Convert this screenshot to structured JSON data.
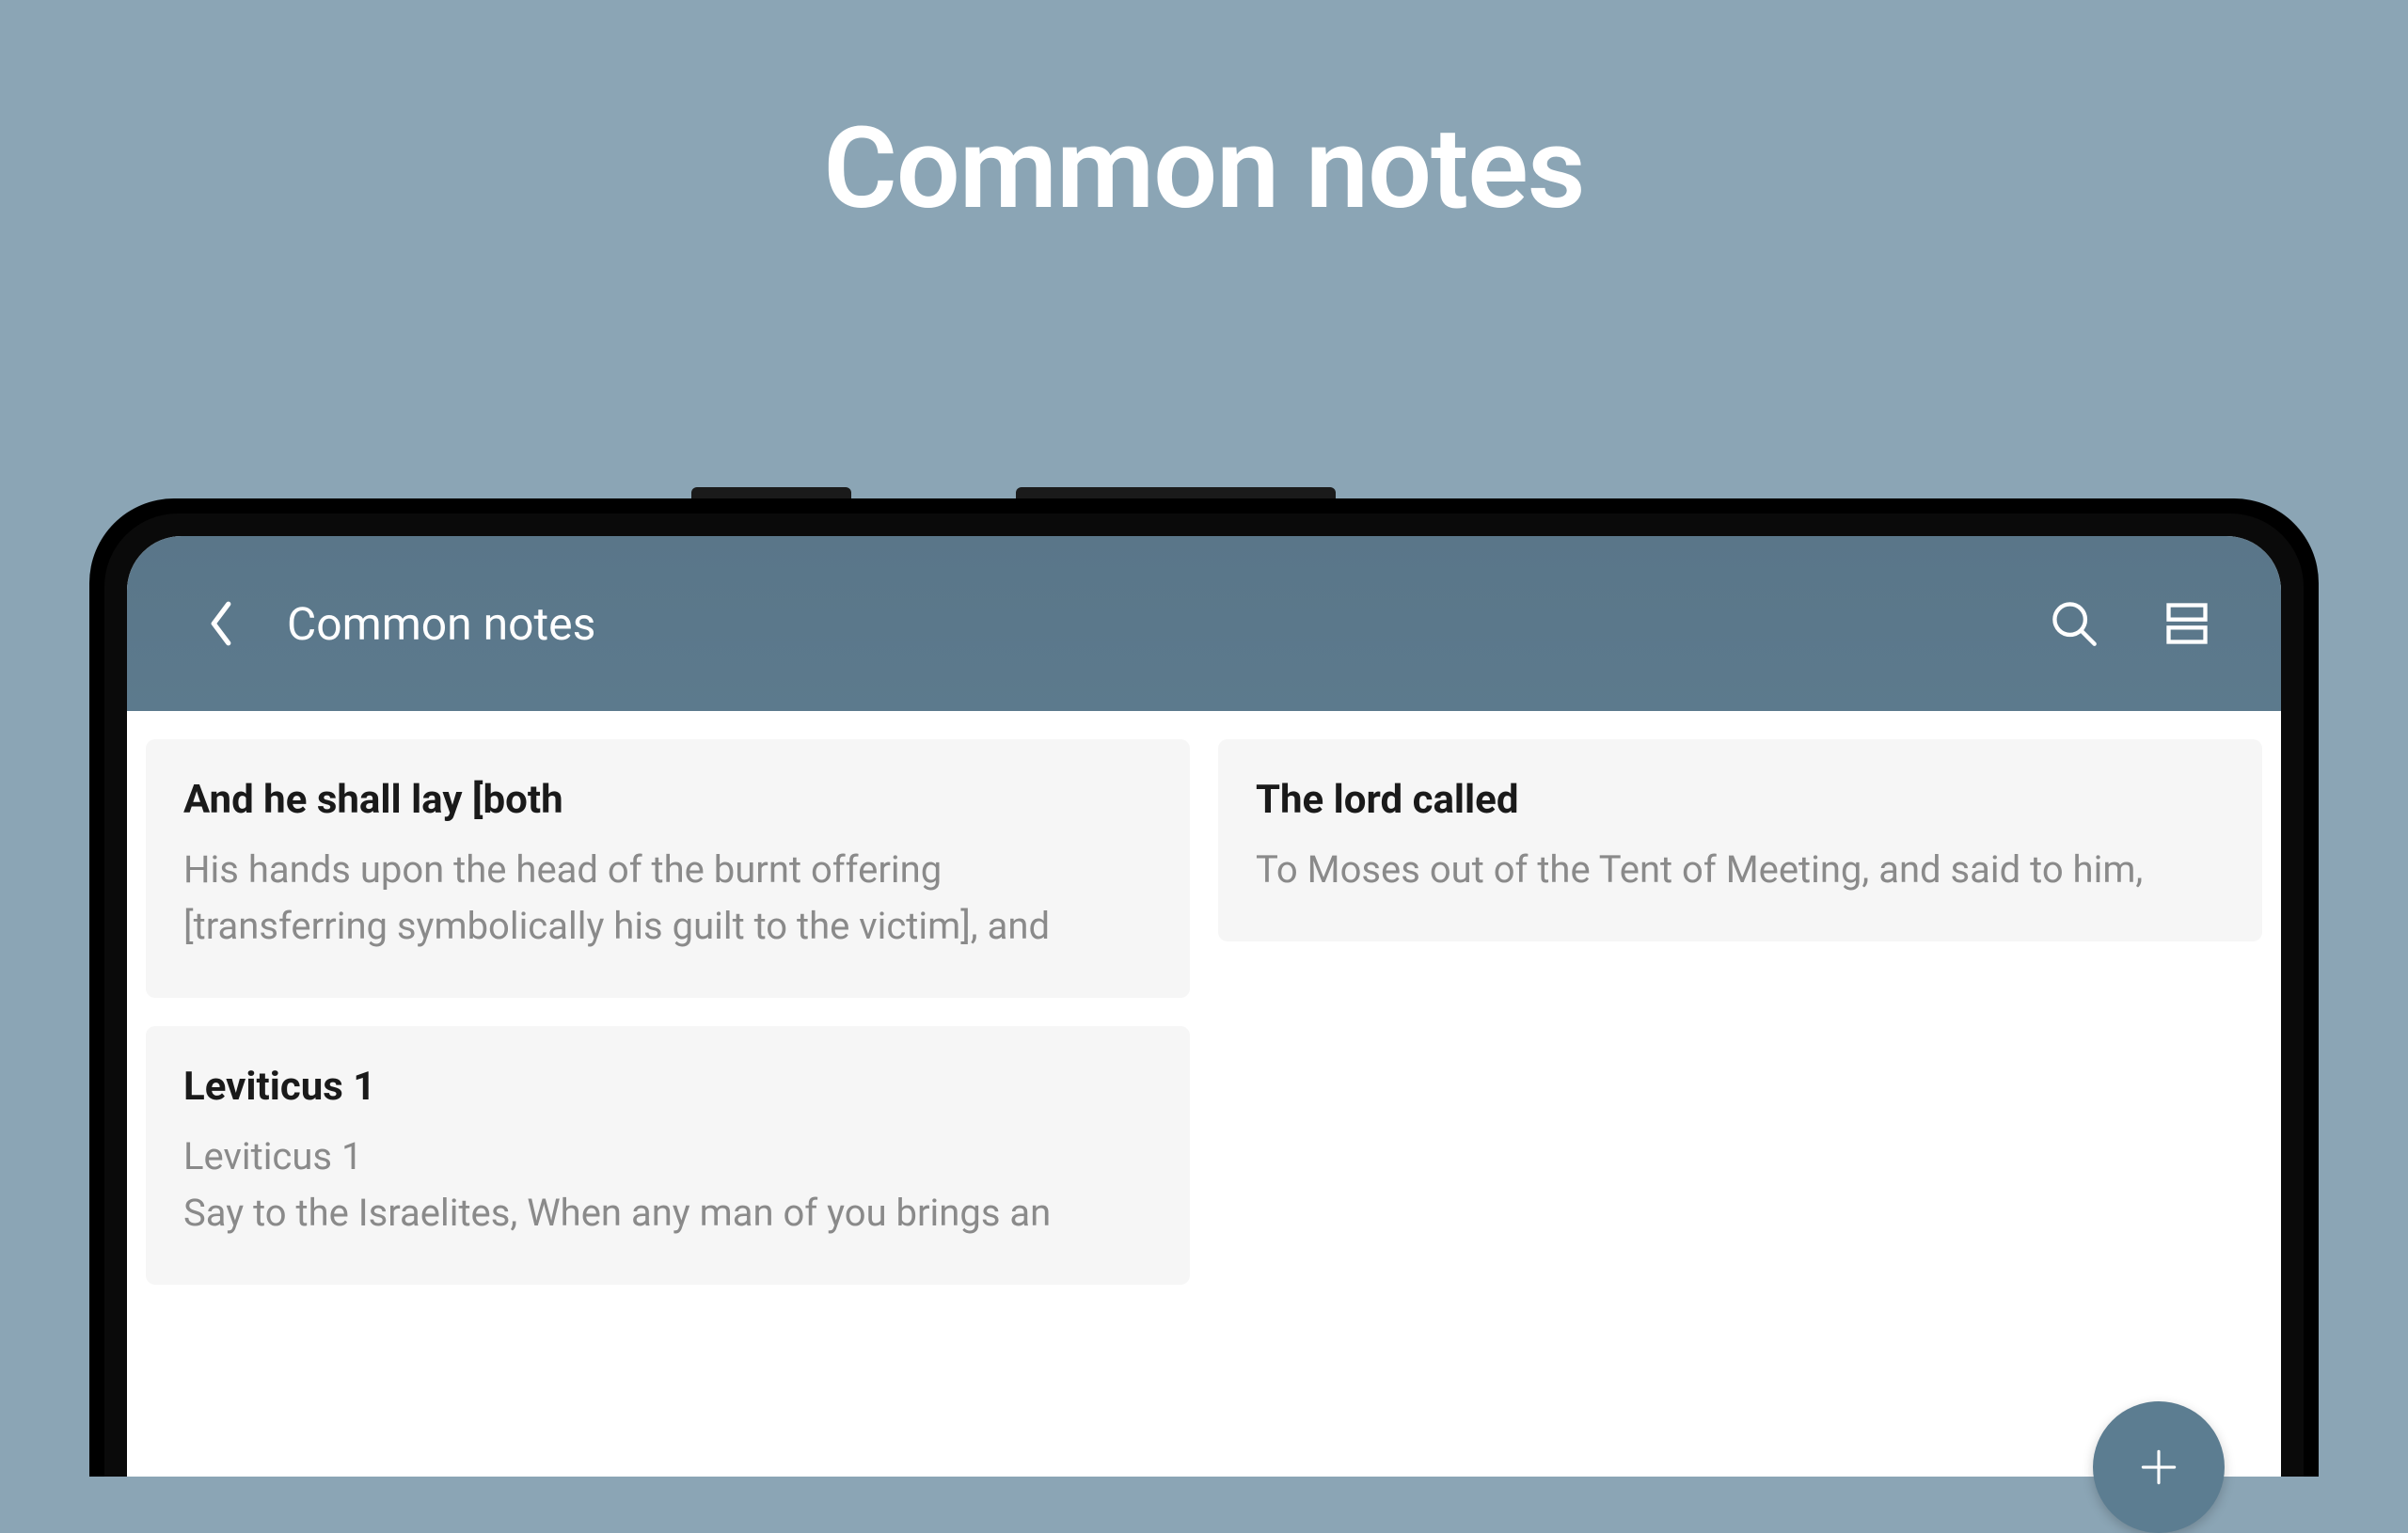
{
  "page": {
    "title": "Common notes"
  },
  "app": {
    "header": {
      "title": "Common notes"
    },
    "notes": {
      "left": [
        {
          "title": "And he shall lay [both",
          "body": "His hands upon the head of the burnt offering [transferring symbolically his guilt to the victim], and"
        },
        {
          "title": "Leviticus 1",
          "body": "Leviticus 1\nSay to the Israelites, When any man of you brings an"
        }
      ],
      "right": [
        {
          "title": "The lord called",
          "body": "To Moses out of the Tent of Meeting, and said to him,"
        }
      ]
    }
  },
  "colors": {
    "background": "#8ba5b5",
    "header": "#5c7a8d",
    "fab": "#5c7d91"
  }
}
